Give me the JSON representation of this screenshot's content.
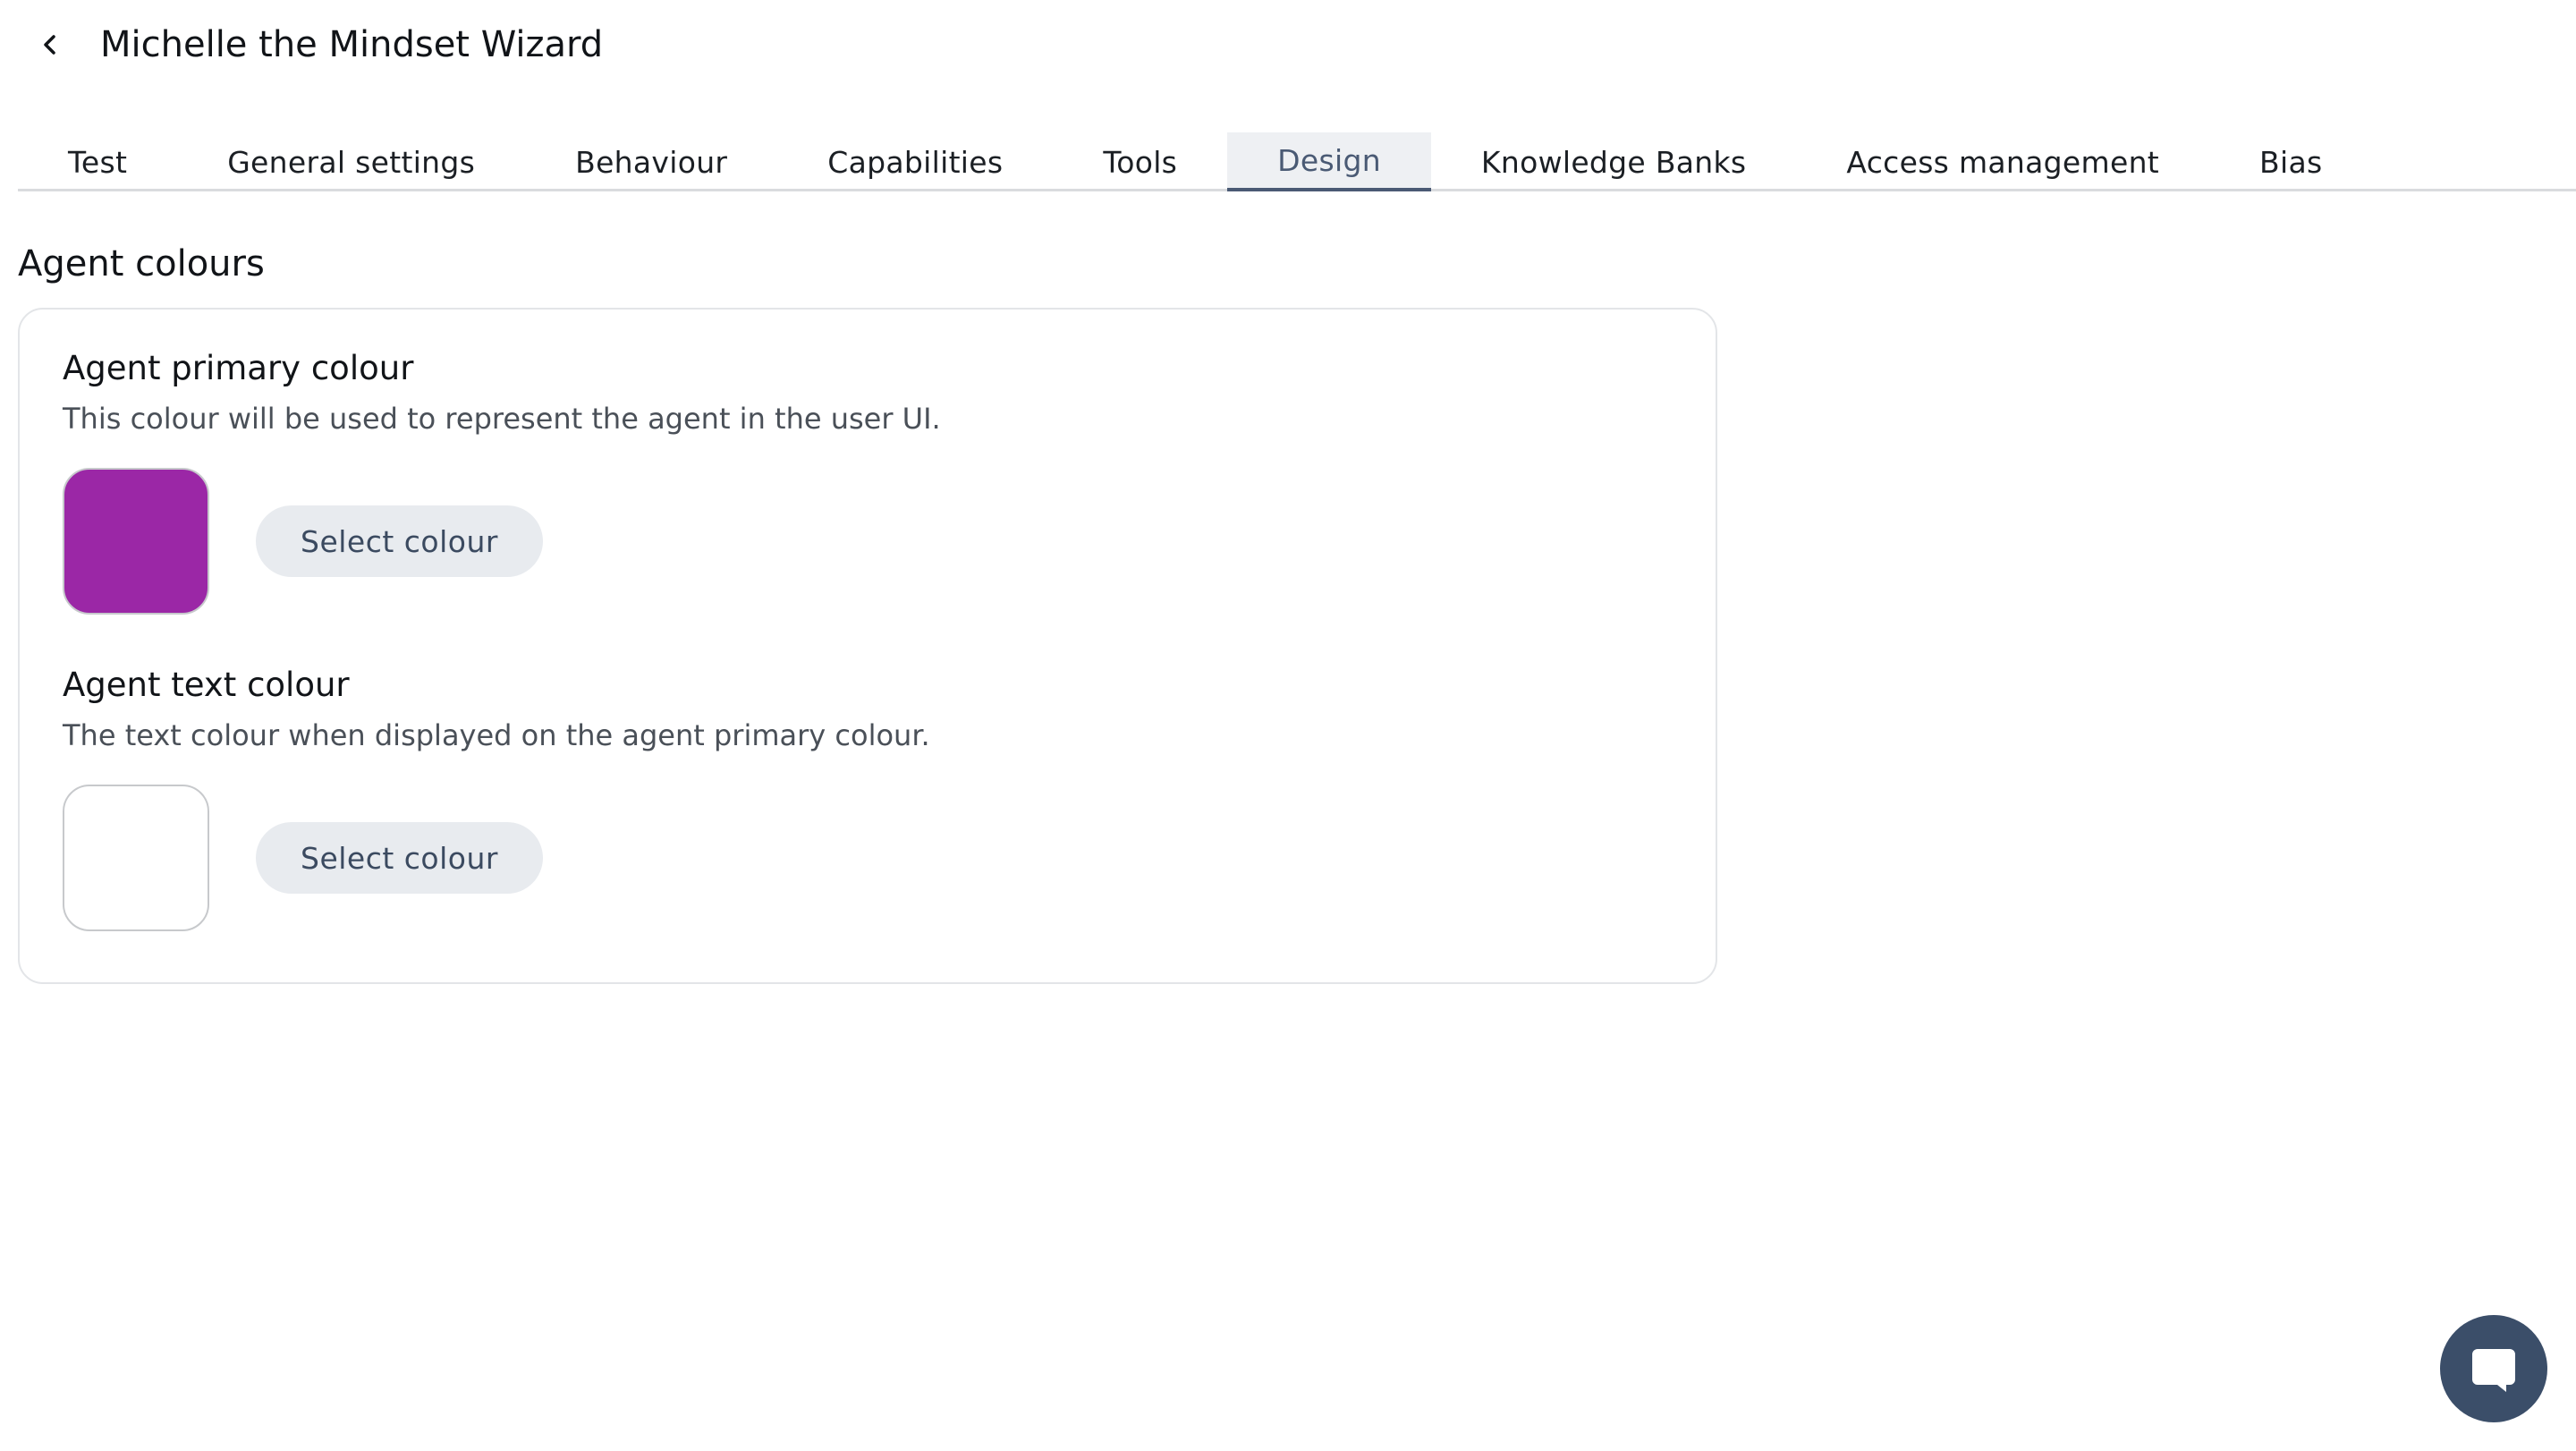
{
  "header": {
    "title": "Michelle the Mindset Wizard",
    "back_icon": "chevron-left-icon"
  },
  "tabs": [
    {
      "label": "Test",
      "active": false
    },
    {
      "label": "General settings",
      "active": false
    },
    {
      "label": "Behaviour",
      "active": false
    },
    {
      "label": "Capabilities",
      "active": false
    },
    {
      "label": "Tools",
      "active": false
    },
    {
      "label": "Design",
      "active": true
    },
    {
      "label": "Knowledge Banks",
      "active": false
    },
    {
      "label": "Access management",
      "active": false
    },
    {
      "label": "Bias",
      "active": false
    }
  ],
  "section": {
    "title": "Agent colours"
  },
  "primary_colour": {
    "title": "Agent primary colour",
    "description": "This colour will be used to represent the agent in the user UI.",
    "swatch_color": "#9b27a6",
    "button_label": "Select colour"
  },
  "text_colour": {
    "title": "Agent text colour",
    "description": "The text colour when displayed on the agent primary colour.",
    "swatch_color": "#ffffff",
    "button_label": "Select colour"
  },
  "chat_widget": {
    "icon": "chat-bubble-icon",
    "color": "#3b4e69"
  },
  "colors": {
    "active_tab": "#4a5a74",
    "button_bg": "#e8ebef"
  }
}
